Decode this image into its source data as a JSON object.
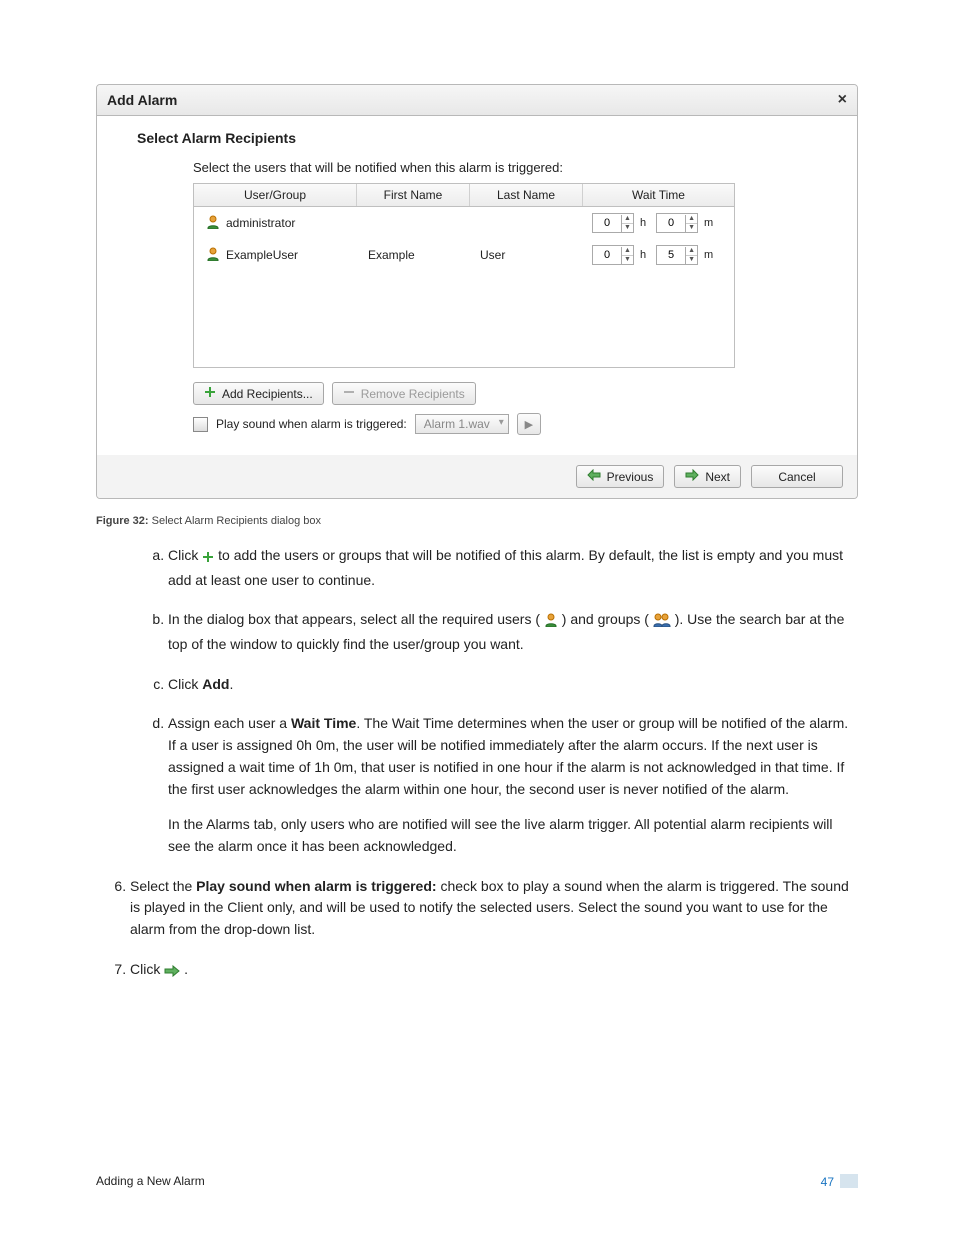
{
  "dialog": {
    "title": "Add Alarm",
    "close_glyph": "×",
    "section_title": "Select Alarm Recipients",
    "instruction": "Select the users that will be notified when this alarm is triggered:",
    "columns": {
      "c1": "User/Group",
      "c2": "First Name",
      "c3": "Last Name",
      "c4": "Wait Time"
    },
    "rows": [
      {
        "user": "administrator",
        "first": "",
        "last": "",
        "hours": "0",
        "mins": "0"
      },
      {
        "user": "ExampleUser",
        "first": "Example",
        "last": "User",
        "hours": "0",
        "mins": "5"
      }
    ],
    "units": {
      "h": "h",
      "m": "m"
    },
    "add_label": "Add Recipients...",
    "remove_label": "Remove Recipients",
    "play_sound_label": "Play sound when alarm is triggered:",
    "sound_file": "Alarm 1.wav",
    "prev": "Previous",
    "next": "Next",
    "cancel": "Cancel"
  },
  "caption": {
    "prefix": "Figure 32:",
    "text": " Select Alarm Recipients dialog box"
  },
  "steps_alpha": {
    "a_pre": "Click ",
    "a_post": " to add the users or groups that will be notified of this alarm. By default, the list is empty and you must add at least one user to continue.",
    "b_pre": "In the dialog box that appears, select all the required users (",
    "b_mid": ") and groups (",
    "b_post": "). Use the search bar at the top of the window to quickly find the user/group you want.",
    "c_pre": "Click ",
    "c_bold": "Add",
    "c_post": ".",
    "d_pre": "Assign each user a ",
    "d_bold": "Wait Time",
    "d_post": ". The Wait Time determines when the user or group will be notified of the alarm. If a user is assigned 0h 0m, the user will be notified immediately after the alarm occurs. If the next user is assigned a wait time of 1h 0m, that user is notified in one hour if the alarm is not acknowledged in that time. If the first user acknowledges the alarm within one hour, the second user is never notified of the alarm.",
    "d_para2": "In the Alarms tab, only users who are notified will see the live alarm trigger. All potential alarm recipients will see the alarm once it has been acknowledged."
  },
  "steps_num": {
    "six_pre": "Select the ",
    "six_bold": "Play sound when alarm is triggered:",
    "six_post": " check box to play a sound when the alarm is triggered. The sound is played in the Client only, and will be used to notify the selected users. Select the sound you want to use for the alarm from the drop-down list.",
    "seven_pre": "Click ",
    "seven_post": "."
  },
  "footer": {
    "left": "Adding a New Alarm",
    "page": "47"
  }
}
